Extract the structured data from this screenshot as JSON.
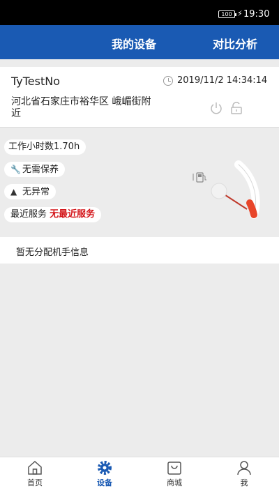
{
  "status_bar": {
    "battery": "100",
    "time": "19:30"
  },
  "header": {
    "tab_devices": "我的设备",
    "tab_compare": "对比分析"
  },
  "device": {
    "name": "TyTestNo",
    "time": "2019/11/2 14:34:14",
    "address": "河北省石家庄市裕华区 峨嵋街附近"
  },
  "status": {
    "work_hours": "工作小时数1.70h",
    "maintenance": "无需保养",
    "abnormal": "无异常",
    "recent_service_label": "最近服务",
    "recent_service_value": "无最近服务"
  },
  "operator": {
    "info": "暂无分配机手信息"
  },
  "tabbar": {
    "home": "首页",
    "device": "设备",
    "mall": "商城",
    "me": "我"
  },
  "colors": {
    "brand": "#1a5ab3",
    "alert": "#d4161b",
    "gauge": "#e8452a"
  }
}
